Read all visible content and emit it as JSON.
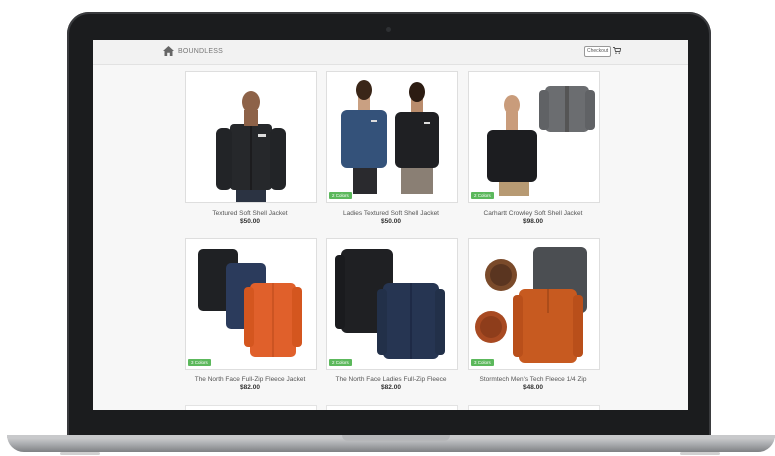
{
  "nav": {
    "brand": "BOUNDLESS",
    "checkout": "Checkout",
    "home_icon": "home-icon",
    "cart_icon": "shopping-cart-icon"
  },
  "colors": {
    "badge": "#5cb85c",
    "page_bg": "#f7f7f7"
  },
  "products": [
    {
      "name": "Textured Soft Shell Jacket",
      "price": "$50.00",
      "badge": ""
    },
    {
      "name": "Ladies Textured Soft Shell Jacket",
      "price": "$50.00",
      "badge": "2 Colors"
    },
    {
      "name": "Carhartt Crowley Soft Shell Jacket",
      "price": "$98.00",
      "badge": "2 Colors"
    },
    {
      "name": "The North Face Full-Zip Fleece Jacket",
      "price": "$82.00",
      "badge": "3 Colors"
    },
    {
      "name": "The North Face Ladies Full-Zip Fleece",
      "price": "$82.00",
      "badge": "2 Colors"
    },
    {
      "name": "Stormtech Men's Tech Fleece 1/4 Zip",
      "price": "$48.00",
      "badge": "3 Colors"
    }
  ]
}
